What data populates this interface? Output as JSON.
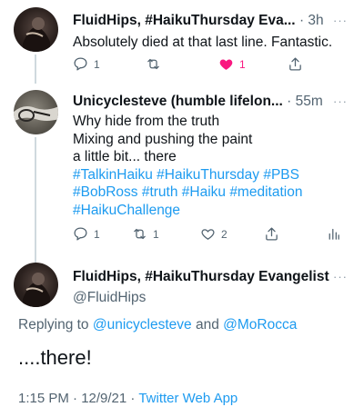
{
  "tweets": [
    {
      "author": "FluidHips, #HaikuThursday Eva...",
      "meta": "· 3h",
      "body": [
        "Absolutely died at that last line. Fantastic."
      ],
      "replies": "1",
      "retweets": "",
      "likes": "1",
      "liked": true
    },
    {
      "author": "Unicyclesteve (humble lifelon...",
      "meta": "· 55m",
      "body": [
        "Why hide from the truth",
        "Mixing and pushing the paint",
        "a little bit... there"
      ],
      "hashtags": [
        "#TalkinHaiku #HaikuThursday #PBS",
        "#BobRoss #truth #Haiku #meditation",
        "#HaikuChallenge"
      ],
      "replies": "1",
      "retweets": "1",
      "likes": "2",
      "liked": false
    }
  ],
  "main_tweet": {
    "author": "FluidHips, #HaikuThursday Evangelist",
    "handle": "@FluidHips",
    "replying_prefix": "Replying to",
    "replying_to_1": "@unicyclesteve",
    "replying_and": "and",
    "replying_to_2": "@MoRocca",
    "text": "....there!",
    "time_date": "1:15 PM · 12/9/21 ·",
    "source": "Twitter Web App"
  },
  "more_glyph": "···",
  "colors": {
    "link": "#1d9bf0",
    "like_active": "#f91880",
    "secondary": "#536471"
  },
  "icons": [
    "reply-icon",
    "retweet-icon",
    "like-icon",
    "share-icon",
    "analytics-icon",
    "more-icon"
  ]
}
